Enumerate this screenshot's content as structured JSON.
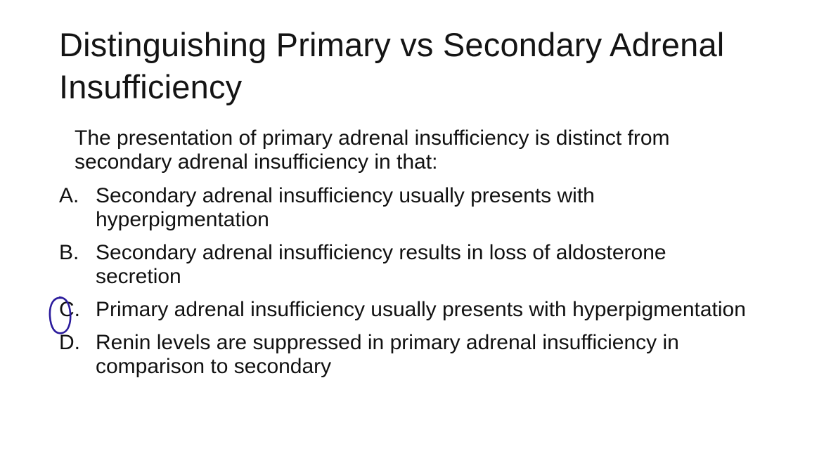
{
  "slide": {
    "title": "Distinguishing Primary vs Secondary Adrenal Insufficiency",
    "question": "The presentation of primary adrenal insufficiency is distinct from secondary adrenal insufficiency in that:",
    "options": [
      {
        "letter": "A.",
        "text": "Secondary adrenal insufficiency usually presents with hyperpigmentation"
      },
      {
        "letter": "B.",
        "text": "Secondary adrenal insufficiency results in loss of aldosterone secretion"
      },
      {
        "letter": "C.",
        "text": "Primary adrenal insufficiency usually presents with hyperpigmentation"
      },
      {
        "letter": "D.",
        "text": "Renin levels are suppressed in primary adrenal insufficiency in comparison to secondary"
      }
    ],
    "annotation_color": "#2a1a9c"
  }
}
